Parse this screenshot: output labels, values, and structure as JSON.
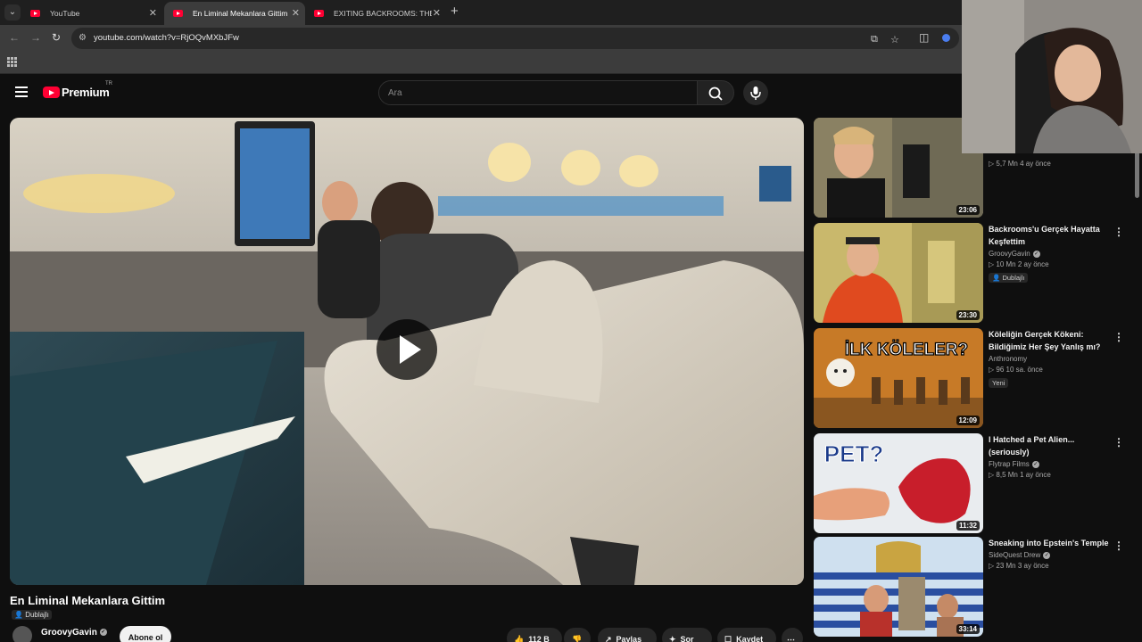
{
  "browser": {
    "tabs": [
      {
        "title": "YouTube"
      },
      {
        "title": "En Liminal Mekanlara Gittim"
      },
      {
        "title": "EXITING BACKROOMS: THE END"
      }
    ],
    "url": "youtube.com/watch?v=RjOQvMXbJFw"
  },
  "header": {
    "logo_text": "Premium",
    "region": "TR",
    "search_placeholder": "Ara"
  },
  "video": {
    "title": "En Liminal Mekanlara Gittim",
    "dubbed_label": "Dublajlı",
    "channel": "GroovyGavin",
    "subscribe_label": "Abone ol",
    "likes": "112 B",
    "share_label": "Paylaş",
    "ask_label": "Sor",
    "save_label": "Kaydet"
  },
  "recommendations": [
    {
      "title": "",
      "channel": "",
      "meta": "5,7 Mn   4 ay önce",
      "duration": "23:06",
      "badge": ""
    },
    {
      "title": "Backrooms'u Gerçek Hayatta Keşfettim",
      "channel": "GroovyGavin",
      "meta": "10 Mn   2 ay önce",
      "duration": "23:30",
      "badge": "Dublajlı"
    },
    {
      "title": "Köleliğin Gerçek Kökeni: Bildiğimiz Her Şey Yanlış mı?",
      "channel": "Anthronomy",
      "meta": "96   10 sa. önce",
      "duration": "12:09",
      "badge": "Yeni",
      "thumb_text": "İLK KÖLELER?"
    },
    {
      "title": "I Hatched a Pet Alien... (seriously)",
      "channel": "Flytrap Films",
      "meta": "8,5 Mn   1 ay önce",
      "duration": "11:32",
      "badge": "",
      "thumb_text": "PET?"
    },
    {
      "title": "Sneaking into Epstein's Temple",
      "channel": "SideQuest Drew",
      "meta": "23 Mn   3 ay önce",
      "duration": "33:14",
      "badge": ""
    }
  ],
  "colors": {
    "brand_red": "#ff0033",
    "background": "#0f0f0f"
  }
}
